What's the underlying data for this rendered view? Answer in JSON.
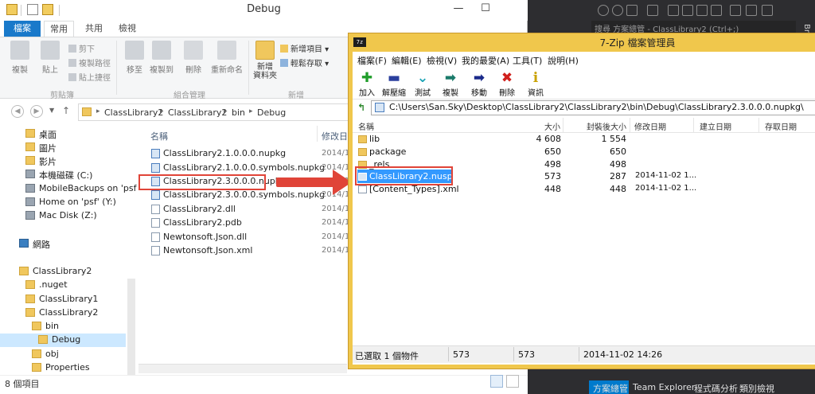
{
  "explorer": {
    "title": "Debug",
    "window_controls": [
      "—",
      "☐",
      "✕"
    ],
    "tabs": {
      "file": "檔案",
      "home": "常用",
      "share": "共用",
      "view": "檢視"
    },
    "ribbon": {
      "copy": "複製",
      "paste": "貼上",
      "cut": "剪下",
      "copy_path": "複製路徑",
      "paste_shortcut": "貼上捷徑",
      "move_to": "移至",
      "copy_to": "複製到",
      "delete": "刪除",
      "rename": "重新命名",
      "new_folder": "新增\n資料夾",
      "new_item": "新增項目",
      "easy_access": "輕鬆存取",
      "group_clipboard": "剪貼簿",
      "group_organize": "組合管理",
      "group_new": "新增"
    },
    "address": {
      "crumbs": [
        "ClassLibrary2",
        "ClassLibrary2",
        "bin",
        "Debug"
      ]
    },
    "nav": [
      {
        "label": "桌面",
        "icon": "folder-icon"
      },
      {
        "label": "圖片",
        "icon": "folder-icon"
      },
      {
        "label": "影片",
        "icon": "folder-icon"
      },
      {
        "label": "本機磁碟 (C:)",
        "icon": "drive-icon"
      },
      {
        "label": "MobileBackups on 'psf'",
        "icon": "network-drive-icon"
      },
      {
        "label": "Home on 'psf' (Y:)",
        "icon": "network-drive-icon"
      },
      {
        "label": "Mac Disk (Z:)",
        "icon": "network-drive-icon"
      },
      {
        "label": "網路",
        "icon": "network-icon"
      },
      {
        "label": "ClassLibrary2",
        "icon": "folder-icon"
      },
      {
        "label": ".nuget",
        "icon": "folder-icon"
      },
      {
        "label": "ClassLibrary1",
        "icon": "folder-icon"
      },
      {
        "label": "ClassLibrary2",
        "icon": "folder-icon"
      },
      {
        "label": "bin",
        "icon": "folder-icon"
      },
      {
        "label": "Debug",
        "icon": "folder-icon"
      },
      {
        "label": "obj",
        "icon": "folder-icon"
      },
      {
        "label": "Properties",
        "icon": "folder-icon"
      }
    ],
    "columns": {
      "name": "名稱",
      "date": "修改日"
    },
    "files": [
      {
        "name": "ClassLibrary2.1.0.0.0.nupkg",
        "date": "2014/1"
      },
      {
        "name": "ClassLibrary2.1.0.0.0.symbols.nupkg",
        "date": "2014/1"
      },
      {
        "name": "ClassLibrary2.3.0.0.0.nupkg",
        "date": "2014/1"
      },
      {
        "name": "ClassLibrary2.3.0.0.0.symbols.nupkg",
        "date": "2014/1"
      },
      {
        "name": "ClassLibrary2.dll",
        "date": "2014/1"
      },
      {
        "name": "ClassLibrary2.pdb",
        "date": "2014/1"
      },
      {
        "name": "Newtonsoft.Json.dll",
        "date": "2014/1"
      },
      {
        "name": "Newtonsoft.Json.xml",
        "date": "2014/1"
      }
    ],
    "status": "8 個項目"
  },
  "sevenzip": {
    "logo": "7z",
    "title": "7-Zip 檔案管理員",
    "menu": [
      "檔案(F)",
      "編輯(E)",
      "檢視(V)",
      "我的最愛(A)",
      "工具(T)",
      "說明(H)"
    ],
    "tools": [
      {
        "label": "加入",
        "symbol": "✚",
        "color": "#1f9d2a"
      },
      {
        "label": "解壓縮",
        "symbol": "▬",
        "color": "#2a3f9d"
      },
      {
        "label": "測試",
        "symbol": "⌄",
        "color": "#1aa3b5"
      },
      {
        "label": "複製",
        "symbol": "➡",
        "color": "#1a7a6a"
      },
      {
        "label": "移動",
        "symbol": "➡",
        "color": "#1a2a8a"
      },
      {
        "label": "刪除",
        "symbol": "✖",
        "color": "#d0201c"
      },
      {
        "label": "資訊",
        "symbol": "i",
        "color": "#c9a100"
      }
    ],
    "address": "C:\\Users\\San.Sky\\Desktop\\ClassLibrary2\\ClassLibrary2\\bin\\Debug\\ClassLibrary2.3.0.0.0.nupkg\\",
    "columns": {
      "name": "名稱",
      "size": "大小",
      "packed": "封裝後大小",
      "modified": "修改日期",
      "created": "建立日期",
      "accessed": "存取日期"
    },
    "rows": [
      {
        "name": "lib",
        "size": "4 608",
        "packed": "1 554",
        "modified": "",
        "type": "folder"
      },
      {
        "name": "package",
        "size": "650",
        "packed": "650",
        "modified": "",
        "type": "folder"
      },
      {
        "name": "_rels",
        "size": "498",
        "packed": "498",
        "modified": "",
        "type": "folder"
      },
      {
        "name": "ClassLibrary2.nuspec",
        "size": "573",
        "packed": "287",
        "modified": "2014-11-02 1...",
        "type": "file"
      },
      {
        "name": "[Content_Types].xml",
        "size": "448",
        "packed": "448",
        "modified": "2014-11-02 1...",
        "type": "file"
      }
    ],
    "status": {
      "selected": "已選取 1 個物件",
      "size": "573",
      "packed": "573",
      "date": "2014-11-02 14:26"
    }
  },
  "vs": {
    "search": "搜尋 方案總管 - ClassLibrary2 (Ctrl+;)",
    "side_tabs": [
      "Brows"
    ],
    "bottom_tabs": [
      "方案總管",
      "Team Explorer",
      "程式碼分析",
      "類別檢視"
    ]
  },
  "colors": {
    "highlight": "#e04438",
    "selection": "#3399ff",
    "sevenzip_frame": "#f0c74c",
    "accent": "#1979ca"
  }
}
